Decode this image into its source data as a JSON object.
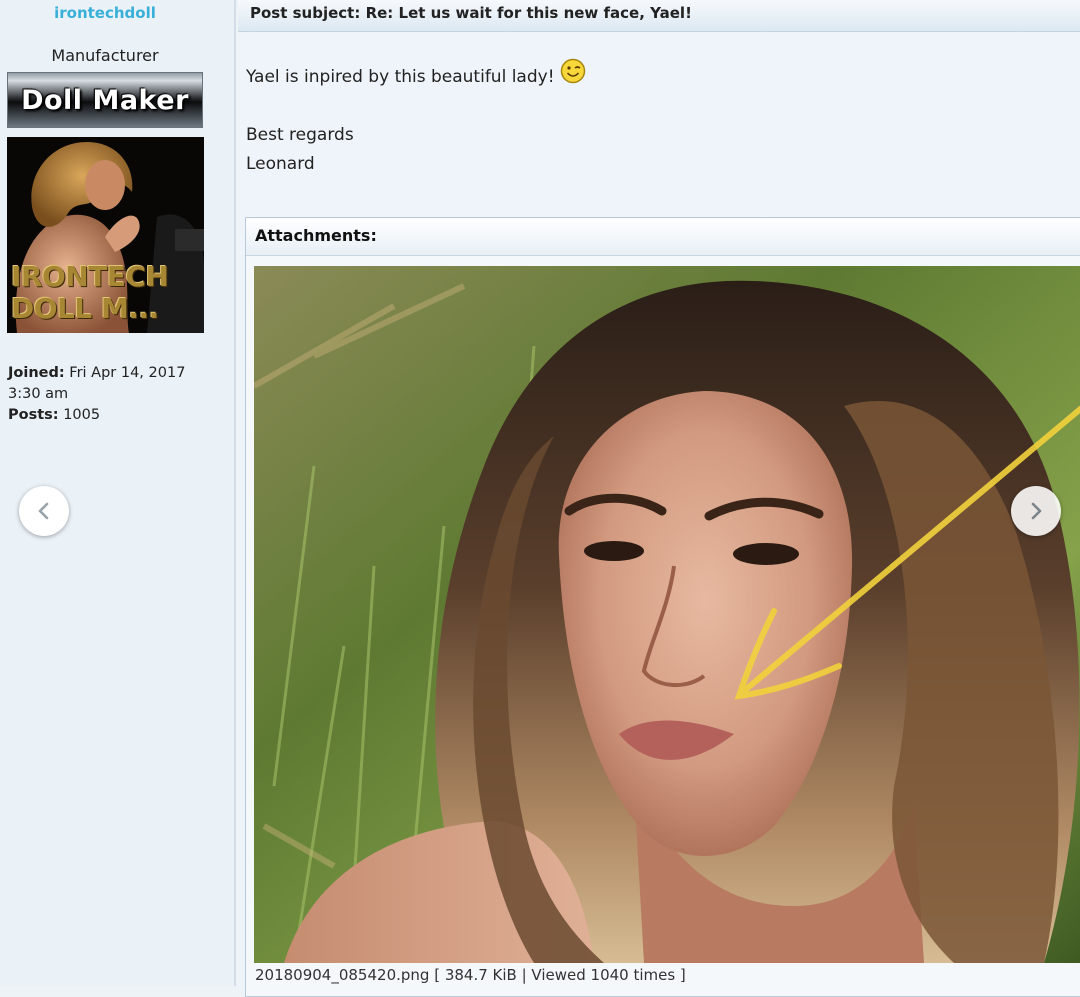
{
  "profile": {
    "username": "irontechdoll",
    "rank": "Manufacturer",
    "rank_image_text": "Doll Maker",
    "avatar_text_line1": "IRONTECH",
    "avatar_text_line2": "DOLL M...",
    "joined_label": "Joined:",
    "joined_value": "Fri Apr 14, 2017 3:30 am",
    "posts_label": "Posts:",
    "posts_value": "1005"
  },
  "post": {
    "subject_label": "Post subject:",
    "subject_value": "Re: Let us wait for this new face, Yael!",
    "body_line1": "Yael is inpired by this beautiful lady!",
    "body_line2": "Best regards",
    "body_line3": "Leonard",
    "smiley_icon": "wink-smiley-icon"
  },
  "attachments": {
    "header": "Attachments:",
    "caption": "20180904_085420.png [ 384.7 KiB | Viewed 1040 times ]"
  },
  "navigation": {
    "prev_icon": "chevron-left-icon",
    "next_icon": "chevron-right-icon"
  },
  "colors": {
    "username": "#39b0d8",
    "page_background": "#eef3f8",
    "annotation_arrow": "#f2d23c"
  }
}
